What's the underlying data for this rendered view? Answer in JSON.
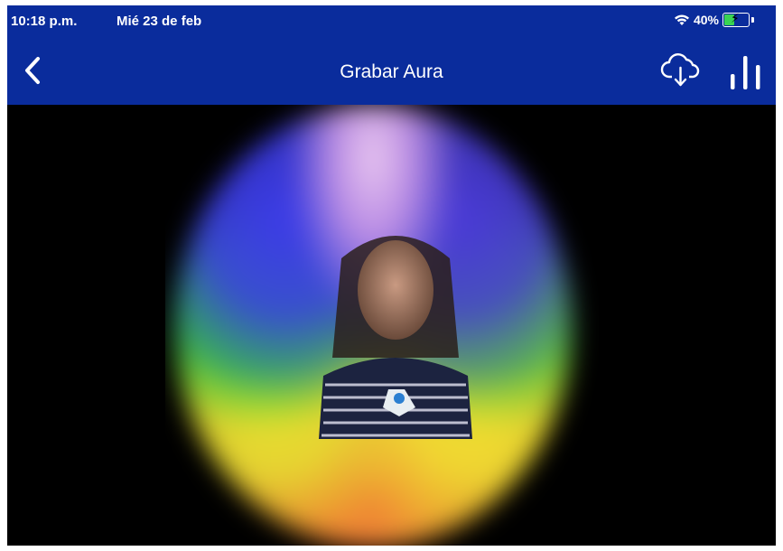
{
  "status_bar": {
    "time": "10:18 p.m.",
    "date": "Mié 23 de feb",
    "battery": "40%"
  },
  "nav": {
    "title": "Grabar Aura",
    "back_icon": "chevron-left-icon",
    "cloud_icon": "cloud-download-icon",
    "levels_icon": "bar-levels-icon"
  },
  "colors": {
    "nav_background": "#0a2c9c",
    "canvas_background": "#000000",
    "battery_fill": "#39d353"
  }
}
